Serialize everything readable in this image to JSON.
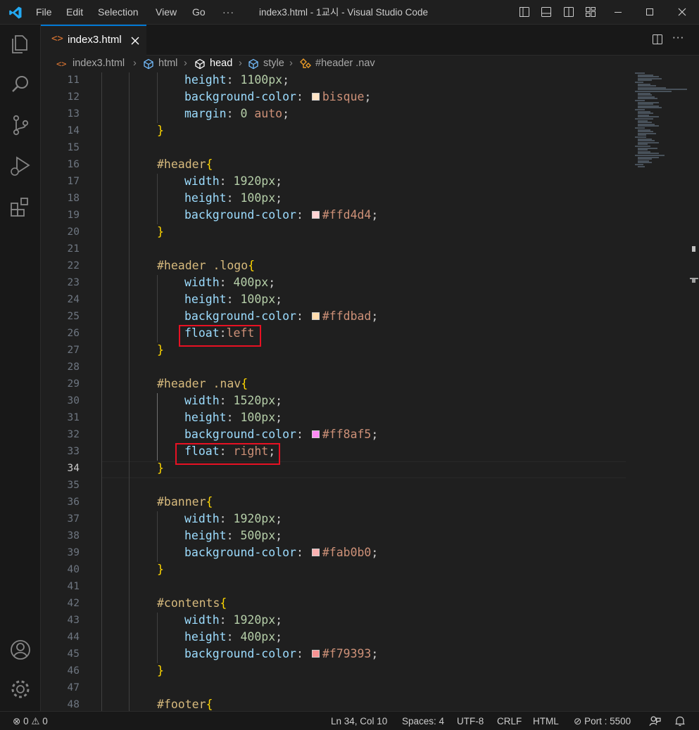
{
  "window": {
    "title": "index3.html - 1교시 - Visual Studio Code",
    "menu": [
      "File",
      "Edit",
      "Selection",
      "View",
      "Go",
      "···"
    ]
  },
  "icons": {
    "app": "vscode-logo-icon",
    "activity": [
      "explorer-icon",
      "search-icon",
      "source-control-icon",
      "run-debug-icon",
      "extensions-icon",
      "accounts-icon",
      "manage-gear-icon"
    ],
    "layout": [
      "toggle-primary-sidebar-icon",
      "toggle-panel-icon",
      "toggle-secondary-sidebar-icon",
      "customize-layout-icon"
    ],
    "window_controls": [
      "minimize-icon",
      "maximize-icon",
      "close-icon"
    ]
  },
  "tab": {
    "label": "index3.html",
    "icon": "html-file-icon",
    "close": "close-icon"
  },
  "breadcrumb": [
    "index3.html",
    "html",
    "head",
    "style",
    "#header .nav"
  ],
  "editor": {
    "lines": [
      {
        "n": "11",
        "text": "height: 1100px;"
      },
      {
        "n": "12",
        "text": "background-color: bisque;"
      },
      {
        "n": "13",
        "text": "margin: 0 auto;"
      },
      {
        "n": "14",
        "text": "}"
      },
      {
        "n": "15",
        "text": ""
      },
      {
        "n": "16",
        "text": "#header{"
      },
      {
        "n": "17",
        "text": "width: 1920px;"
      },
      {
        "n": "18",
        "text": "height: 100px;"
      },
      {
        "n": "19",
        "text": "background-color: #ffd4d4;"
      },
      {
        "n": "20",
        "text": "}"
      },
      {
        "n": "21",
        "text": ""
      },
      {
        "n": "22",
        "text": "#header .logo{"
      },
      {
        "n": "23",
        "text": "width: 400px;"
      },
      {
        "n": "24",
        "text": "height: 100px;"
      },
      {
        "n": "25",
        "text": "background-color: #ffdbad;"
      },
      {
        "n": "26",
        "text": "float:left"
      },
      {
        "n": "27",
        "text": "}"
      },
      {
        "n": "28",
        "text": ""
      },
      {
        "n": "29",
        "text": "#header .nav{"
      },
      {
        "n": "30",
        "text": "width: 1520px;"
      },
      {
        "n": "31",
        "text": "height: 100px;"
      },
      {
        "n": "32",
        "text": "background-color: #ff8af5;"
      },
      {
        "n": "33",
        "text": "float: right;"
      },
      {
        "n": "34",
        "text": "}"
      },
      {
        "n": "35",
        "text": ""
      },
      {
        "n": "36",
        "text": "#banner{"
      },
      {
        "n": "37",
        "text": "width: 1920px;"
      },
      {
        "n": "38",
        "text": "height: 500px;"
      },
      {
        "n": "39",
        "text": "background-color: #fab0b0;"
      },
      {
        "n": "40",
        "text": "}"
      },
      {
        "n": "41",
        "text": ""
      },
      {
        "n": "42",
        "text": "#contents{"
      },
      {
        "n": "43",
        "text": "width: 1920px;"
      },
      {
        "n": "44",
        "text": "height: 400px;"
      },
      {
        "n": "45",
        "text": "background-color: #f79393;"
      },
      {
        "n": "46",
        "text": "}"
      },
      {
        "n": "47",
        "text": ""
      },
      {
        "n": "48",
        "text": "#footer{"
      }
    ],
    "swatches": {
      "bisque": "#ffe4c4",
      "ffd4d4": "#ffd4d4",
      "ffdbad": "#ffdbad",
      "ff8af5": "#ff8af5",
      "fab0b0": "#fab0b0",
      "f79393": "#f79393"
    },
    "current_line": "34"
  },
  "statusbar": {
    "errors": "0",
    "warnings": "0",
    "position": "Ln 34, Col 10",
    "spaces": "Spaces: 4",
    "encoding": "UTF-8",
    "eol": "CRLF",
    "language": "HTML",
    "port": "Port : 5500"
  },
  "colors": {
    "accent": "#0078d4",
    "highlight_box": "#e81123",
    "selector": "#d7ba7d",
    "property": "#9cdcfe",
    "number": "#b5cea8",
    "value": "#ce9178"
  }
}
